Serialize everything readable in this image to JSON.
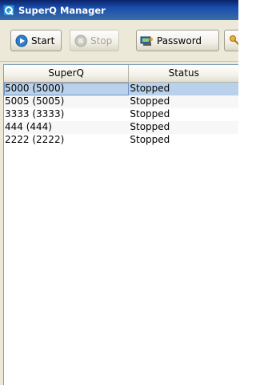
{
  "window": {
    "title": "SuperQ Manager",
    "icon": "superq-app-icon"
  },
  "toolbar": {
    "start_label": "Start",
    "start_icon": "play-circle-icon",
    "stop_label": "Stop",
    "stop_icon": "stop-circle-icon",
    "stop_enabled": false,
    "password_label": "Password",
    "password_icon": "password-key-icon",
    "more_icon": "key-icon"
  },
  "table": {
    "columns": [
      "SuperQ",
      "Status"
    ],
    "rows": [
      {
        "superq": "5000 (5000)",
        "status": "Stopped",
        "selected": true
      },
      {
        "superq": "5005 (5005)",
        "status": "Stopped",
        "selected": false
      },
      {
        "superq": "3333 (3333)",
        "status": "Stopped",
        "selected": false
      },
      {
        "superq": "444 (444)",
        "status": "Stopped",
        "selected": false
      },
      {
        "superq": "2222 (2222)",
        "status": "Stopped",
        "selected": false
      }
    ]
  },
  "colors": {
    "titlebar": "#0a246a",
    "selected_row": "#b9d1ea"
  }
}
